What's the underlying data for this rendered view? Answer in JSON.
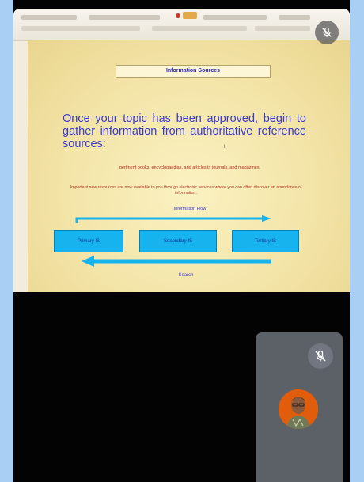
{
  "slide": {
    "title": "Information Sources",
    "heading": "Once your topic has been approved, begin to gather information from authoritative reference sources:",
    "sources": "pertinent books, encyclopaedias, and articles in journals, and magazines.",
    "resources": "Important new resources are now available to you through electronic services where you can often discover an abundance of information.",
    "flow_label": "Information Flow",
    "stages": [
      "Primary IS",
      "Secondary IS",
      "Tertiary IS"
    ],
    "search_label": "Search",
    "cursor": "Ⱶ"
  },
  "colors": {
    "page_background": "#a9cff5",
    "call_background": "#030303",
    "slide_text": "#3a3ad0",
    "slide_note": "#b03020",
    "stage_fill": "#17b3ef",
    "tile": "#5c6168",
    "avatar_ring": "#e15d0b"
  },
  "icons": {
    "share_mute": "microphone-off-icon",
    "self_mute": "microphone-off-icon",
    "avatar": "participant-avatar"
  }
}
